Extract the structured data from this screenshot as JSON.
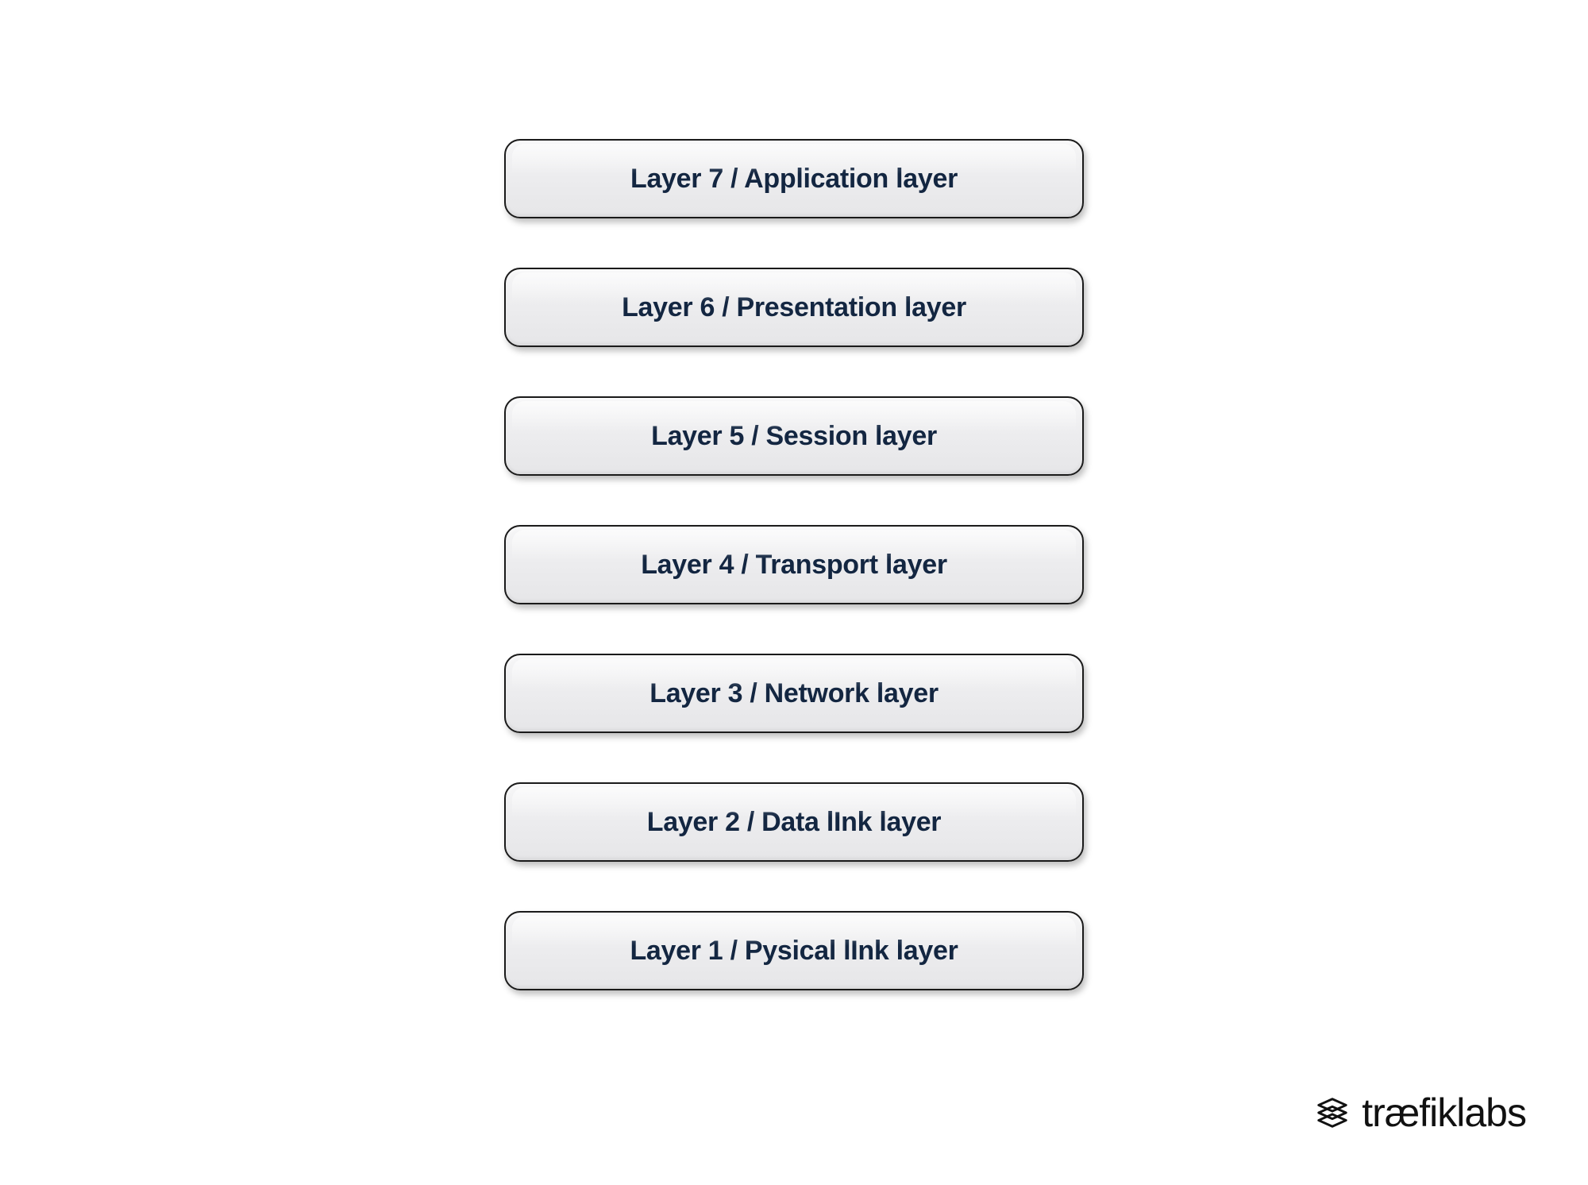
{
  "layers": [
    {
      "label": "Layer 7 / Application layer"
    },
    {
      "label": "Layer 6 / Presentation layer"
    },
    {
      "label": "Layer 5 / Session layer"
    },
    {
      "label": "Layer 4 / Transport layer"
    },
    {
      "label": "Layer 3 / Network layer"
    },
    {
      "label": "Layer 2 / Data lInk layer"
    },
    {
      "label": "Layer 1 / Pysical lInk layer"
    }
  ],
  "brand": {
    "name_bold": "træfik",
    "name_light": "labs"
  }
}
